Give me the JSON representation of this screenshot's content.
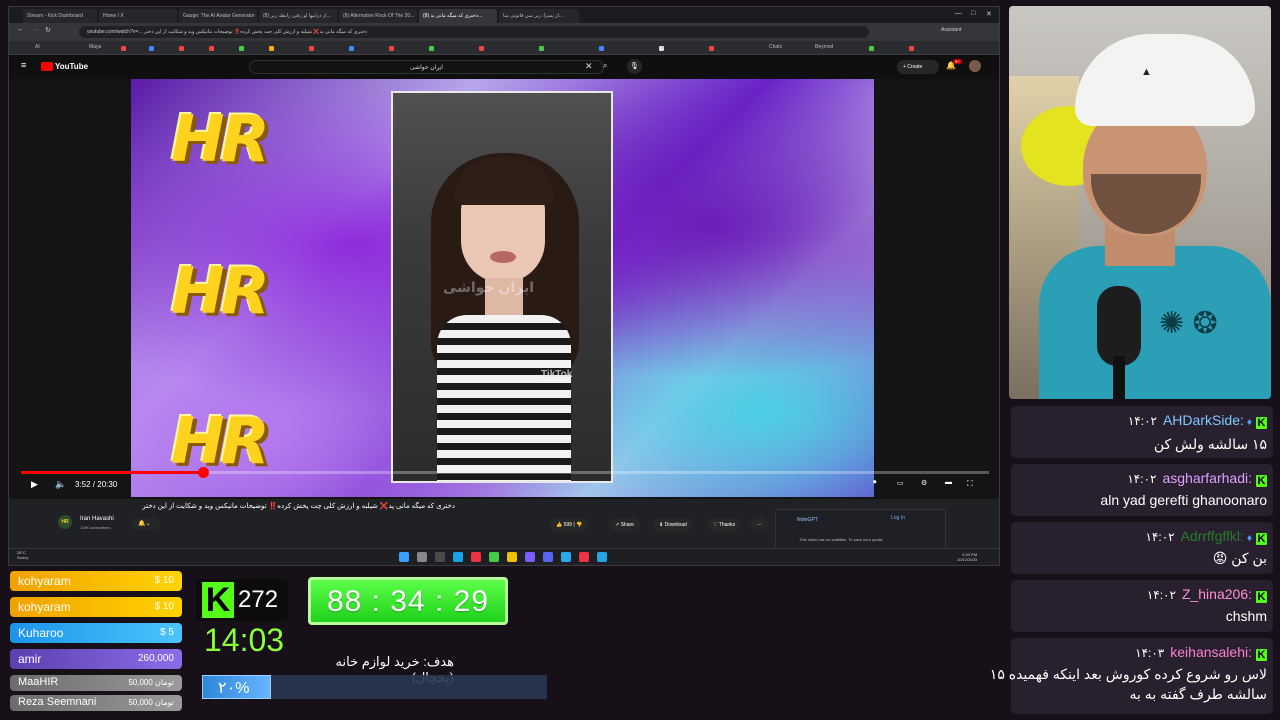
{
  "browser": {
    "tabs": [
      "Stream - Kick Dashboard",
      "Home / X",
      "Gauge: The AI Avatar Generator",
      "(8) از درامها لو رفتن رابطه زیر...",
      "(8) Alternative Rock Of The 20...",
      "(8) دختری که میگه مانی پد...",
      "از پسرا: زیر سن قانونی منا..."
    ],
    "url": "youtube.com/watch?v=... دختری که میگه مانی پد❌ شیلبه و ارزش کلی چت پخش کرده‼️ توضیحات مانیکس وید و شکایت از این دختر",
    "bookmarks": [
      "AI",
      "Maya",
      "Chatx",
      "Beymod"
    ],
    "assistant": "Assistant"
  },
  "youtube": {
    "logo": "YouTube",
    "search_query": "ایران حواشی",
    "create_label": "+ Create",
    "notification_count": "9+",
    "player": {
      "time": "3:52 / 20:30",
      "progress": 0.188,
      "logo_text": "HR",
      "tiktok_mark": "TikTok",
      "watermark": "ایران حواشی"
    },
    "video_title": "دختری که میگه مانی پد❌ شیلبه و ارزش کلی چت پخش کرده‼️ توضیحات مانیکس وید و شکایت از این دختر",
    "channel": {
      "name": "Iran Havashi",
      "subs": "113K subscribers",
      "avatar": "HR"
    },
    "actions": {
      "likes": "599",
      "share": "Share",
      "download": "Download",
      "thanks": "Thanks"
    },
    "notegpt": {
      "title": "NoteGPT",
      "login": "Log In",
      "message": "This video has no subtitles. To save your quota,"
    }
  },
  "taskbar": {
    "weather_temp": "28°C",
    "weather_desc": "Sunny",
    "time": "2:03 PM",
    "date": "10/12/2023"
  },
  "chat": [
    {
      "user": "AHDarkSide",
      "color": "#7ec8ff",
      "time": "۱۴:۰۲",
      "diamond": true,
      "text": "۱۵ سالشه ولش کن"
    },
    {
      "user": "asgharfarhadi",
      "color": "#e0a0ff",
      "time": "۱۴:۰۲",
      "diamond": false,
      "text": "aln yad gerefti ghanoonaro"
    },
    {
      "user": "Adrrffgffkl",
      "color": "#2a7a2a",
      "time": "۱۴:۰۲",
      "diamond": true,
      "text": "بن کن 😡"
    },
    {
      "user": "Z_hina206",
      "color": "#ff8fd6",
      "time": "۱۴:۰۲",
      "diamond": false,
      "text": "chshm"
    },
    {
      "user": "keihansalehi",
      "color": "#ff7fd0",
      "time": "۱۴:۰۳",
      "diamond": false,
      "text": "لاس رو شروع کرده کوروش بعد اینکه فهمیده ۱۵",
      "text2": "سالشه طرف گفته به به"
    }
  ],
  "donations": [
    {
      "name": "kohyaram",
      "amount": "$ 10",
      "style": "gold"
    },
    {
      "name": "kohyaram",
      "amount": "$ 10",
      "style": "gold"
    },
    {
      "name": "Kuharoo",
      "amount": "$ 5",
      "style": "blue"
    },
    {
      "name": "amir",
      "amount": "260,000",
      "style": "purple"
    },
    {
      "name": "MaaHIR",
      "amount": "50,000 تومان",
      "style": "gray"
    },
    {
      "name": "Reza Seemnani",
      "amount": "50,000 تومان",
      "style": "gray"
    }
  ],
  "stream": {
    "kick_logo": "K",
    "viewers": "272",
    "countdown": "88 : 34 : 29",
    "clock": "14:03",
    "goal_label": "هدف: خرید لوازم خانه (یخچال)",
    "goal_percent": "۲۰%",
    "goal_fraction": 0.2
  },
  "colors": {
    "kick_green": "#53fc18",
    "youtube_red": "#ff0000",
    "chat_bg": "#2a2230"
  }
}
